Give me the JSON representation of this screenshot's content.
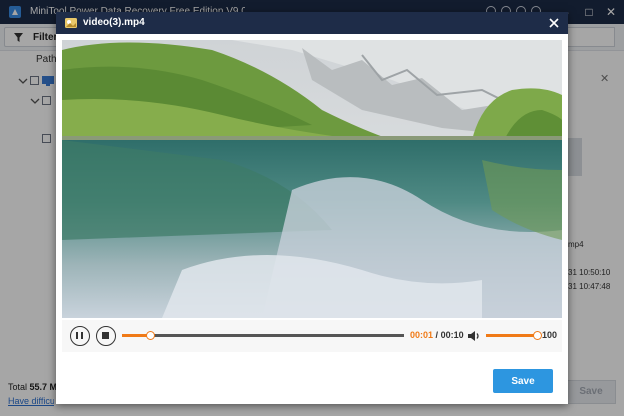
{
  "app": {
    "title": "MiniTool Power Data Recovery Free Edition V9.0",
    "colors": {
      "titlebar": "#1d2b47",
      "accent": "#f07a17",
      "primary_button": "#2d96e0"
    }
  },
  "toolbar": {
    "filter_label": "Filter"
  },
  "tree": {
    "path_header": "Path"
  },
  "details": {
    "type_fragment": "mp4",
    "date_1_fragment": "31 10:50:10",
    "date_2_fragment": "31 10:47:48"
  },
  "footer": {
    "total_label": "Total",
    "total_size": "55.7 MB",
    "help_link": "Have difficulty recovering data?",
    "save_label": "Save"
  },
  "preview": {
    "title": "video(3).mp4",
    "save_label": "Save",
    "player": {
      "current_time": "00:01",
      "separator": "/",
      "duration": "00:10",
      "progress_fraction": 0.1,
      "volume": "100",
      "volume_fraction": 1.0
    }
  }
}
